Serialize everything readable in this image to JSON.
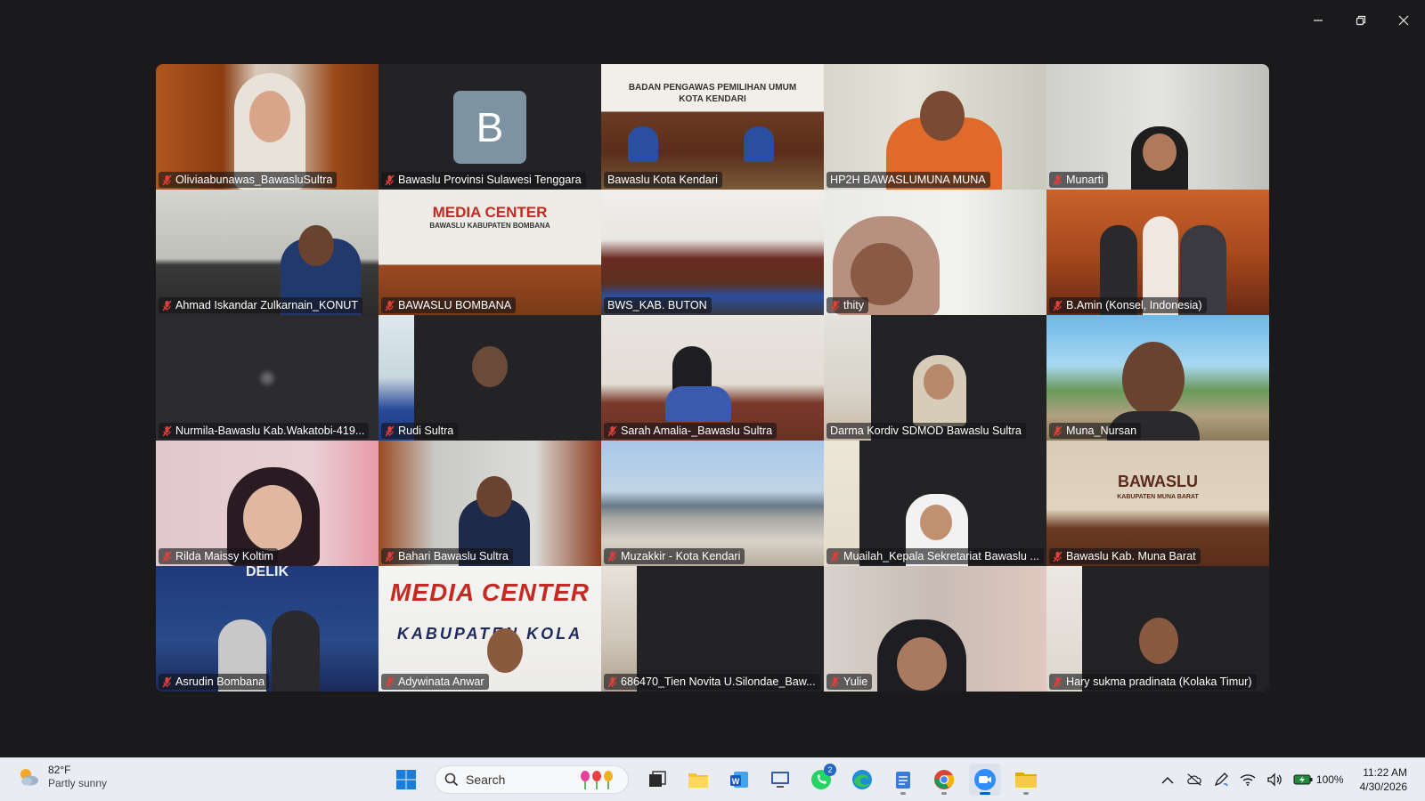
{
  "window": {
    "controls": [
      "minimize",
      "restore",
      "close"
    ]
  },
  "participants": [
    {
      "name": "Oliviaabunawas_BawasluSultra"
    },
    {
      "name": "Bawaslu Provinsi Sulawesi Tenggara",
      "avatar_letter": "B"
    },
    {
      "name": "Bawaslu Kota Kendari",
      "banner": "BADAN PENGAWAS PEMILIHAN UMUM\nKOTA KENDARI"
    },
    {
      "name": "HP2H BAWASLUMUNA MUNA"
    },
    {
      "name": "Munarti"
    },
    {
      "name": "Ahmad Iskandar Zulkarnain_KONUT"
    },
    {
      "name": "BAWASLU BOMBANA",
      "banner": "MEDIA CENTER",
      "banner_sub": "BAWASLU KABUPATEN BOMBANA"
    },
    {
      "name": "BWS_KAB. BUTON"
    },
    {
      "name": "thity"
    },
    {
      "name": "B.Amin (Konsel, Indonesia)"
    },
    {
      "name": "Nurmila-Bawaslu Kab.Wakatobi-419..."
    },
    {
      "name": "Rudi Sultra"
    },
    {
      "name": "Sarah Amalia-_Bawaslu Sultra"
    },
    {
      "name": "Darma Kordiv SDMOD Bawaslu Sultra"
    },
    {
      "name": "Muna_Nursan"
    },
    {
      "name": "Rilda Maissy Koltim"
    },
    {
      "name": "Bahari Bawaslu Sultra"
    },
    {
      "name": "Muzakkir - Kota Kendari"
    },
    {
      "name": "Muailah_Kepala Sekretariat Bawaslu ..."
    },
    {
      "name": "Bawaslu Kab. Muna Barat",
      "banner": "BAWASLU",
      "banner_sub": "KABUPATEN MUNA BARAT"
    },
    {
      "name": "Asrudin Bombana",
      "banner": "DELIK"
    },
    {
      "name": "Adywinata Anwar",
      "banner": "MEDIA CENTER",
      "banner_sub": "KABUPATEN KOLA"
    },
    {
      "name": "686470_Tien Novita U.Silondae_Baw..."
    },
    {
      "name": "Yulie"
    },
    {
      "name": "Hary sukma pradinata (Kolaka Timur)"
    }
  ],
  "taskbar": {
    "weather": {
      "temp": "82°F",
      "condition": "Partly sunny"
    },
    "search": {
      "placeholder": "Search"
    },
    "apps": [
      {
        "icon": "windows-start-icon"
      },
      {
        "icon": "task-view-icon"
      },
      {
        "icon": "file-explorer-icon"
      },
      {
        "icon": "word-icon"
      },
      {
        "icon": "remote-desktop-icon"
      },
      {
        "icon": "whatsapp-icon",
        "badge": "2"
      },
      {
        "icon": "edge-icon"
      },
      {
        "icon": "notepad-icon"
      },
      {
        "icon": "chrome-icon"
      },
      {
        "icon": "zoom-icon"
      },
      {
        "icon": "folder-icon"
      }
    ],
    "tray": {
      "battery": "100%",
      "time": "11:22 AM",
      "date": "4/30/2026"
    }
  },
  "colors": {
    "background": "#1a1a1c",
    "active_speaker": "#2ec866",
    "mute_red": "#e0403a",
    "taskbar": "#e9edf3"
  }
}
